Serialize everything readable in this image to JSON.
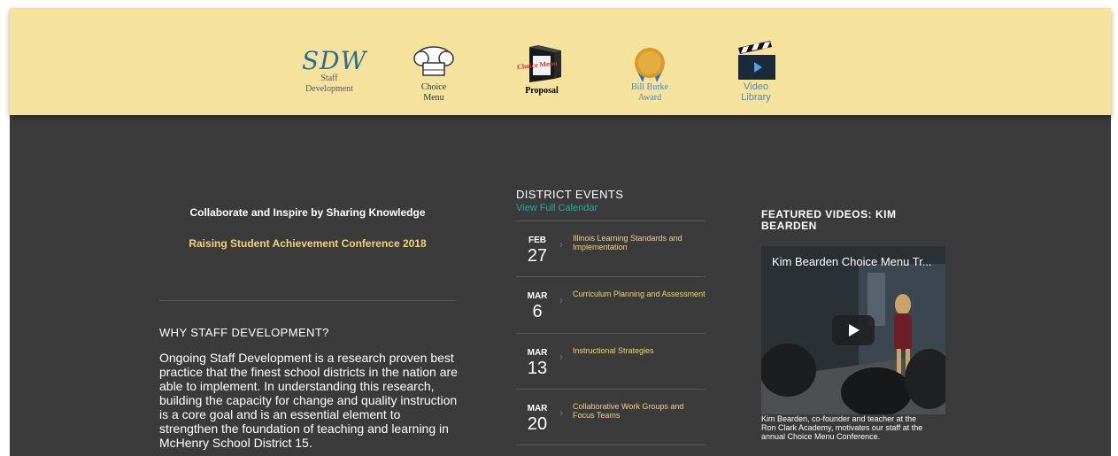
{
  "nav": {
    "staff_dev_logo": "SDW",
    "staff_dev_label_1": "Staff",
    "staff_dev_label_2": "Development",
    "choice_menu_label_1": "Choice",
    "choice_menu_label_2": "Menu",
    "proposal_label": "Proposal",
    "proposal_box_text": "Choice Menu",
    "award_label_1": "Bill Burke",
    "award_label_2": "Award",
    "video_label_1": "Video",
    "video_label_2": "Library"
  },
  "main": {
    "tagline": "Collaborate and Inspire by Sharing Knowledge",
    "conference_link": "Raising Student Achievement Conference 2018",
    "why_title": "WHY STAFF DEVELOPMENT?",
    "why_body": "Ongoing Staff Development is a research proven best practice that the finest school districts in the nation are able to implement. In understanding this research, building the capacity for change and quality instruction is a core goal and is an essential element to strengthen the foundation of teaching and learning in McHenry School District 15."
  },
  "events": {
    "title": "DISTRICT EVENTS",
    "link": "View Full Calendar",
    "items": [
      {
        "month": "FEB",
        "day": "27",
        "title": "Illinois Learning Standards and Implementation"
      },
      {
        "month": "MAR",
        "day": "6",
        "title": "Curriculum Planning and Assessment"
      },
      {
        "month": "MAR",
        "day": "13",
        "title": "Instructional Strategies"
      },
      {
        "month": "MAR",
        "day": "20",
        "title": "Collaborative Work Groups and Focus Teams"
      }
    ]
  },
  "videos": {
    "title": "FEATURED VIDEOS: KIM BEARDEN",
    "video_title": "Kim Bearden Choice Menu Tr...",
    "caption": "Kim Bearden, co-founder and teacher at the Ron Clark Academy, motivates our staff at the annual Choice Menu Conference."
  },
  "colors": {
    "header_bg": "#f5e29d",
    "page_bg": "#3b3b3b",
    "accent_yellow": "#f2d27f",
    "accent_teal": "#2aa7a0"
  }
}
